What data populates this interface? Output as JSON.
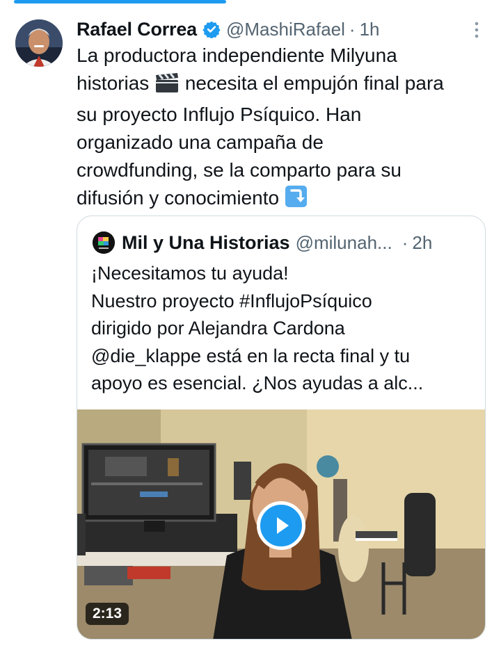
{
  "tweet": {
    "author_name": "Rafael Correa",
    "handle": "@MashiRafael",
    "separator": "·",
    "time": "1h",
    "lines": [
      "La productora independiente Milyuna",
      "historias",
      "necesita el empujón final para",
      "su proyecto Influjo Psíquico. Han",
      "organizado una campaña de",
      "crowdfunding, se la comparto para su",
      "difusión y conocimiento"
    ],
    "icons": [
      "verified-badge-icon",
      "more-options-icon",
      "clapper-board-emoji",
      "arrow-down-emoji"
    ]
  },
  "quote": {
    "author_name": "Mil y Una Historias",
    "handle": "@milunah...",
    "separator": "·",
    "time": "2h",
    "lines": [
      "¡Necesitamos tu ayuda!",
      "Nuestro proyecto #InflujoPsíquico",
      "dirigido por Alejandra Cardona",
      "@die_klappe está en la recta final y tu",
      "apoyo es esencial. ¿Nos ayudas a alc..."
    ],
    "video": {
      "duration": "2:13",
      "icons": [
        "play-icon"
      ]
    }
  },
  "colors": {
    "accent": "#1d9bf0",
    "text": "#0f1419",
    "secondary": "#536471",
    "border": "#cfd9de"
  }
}
